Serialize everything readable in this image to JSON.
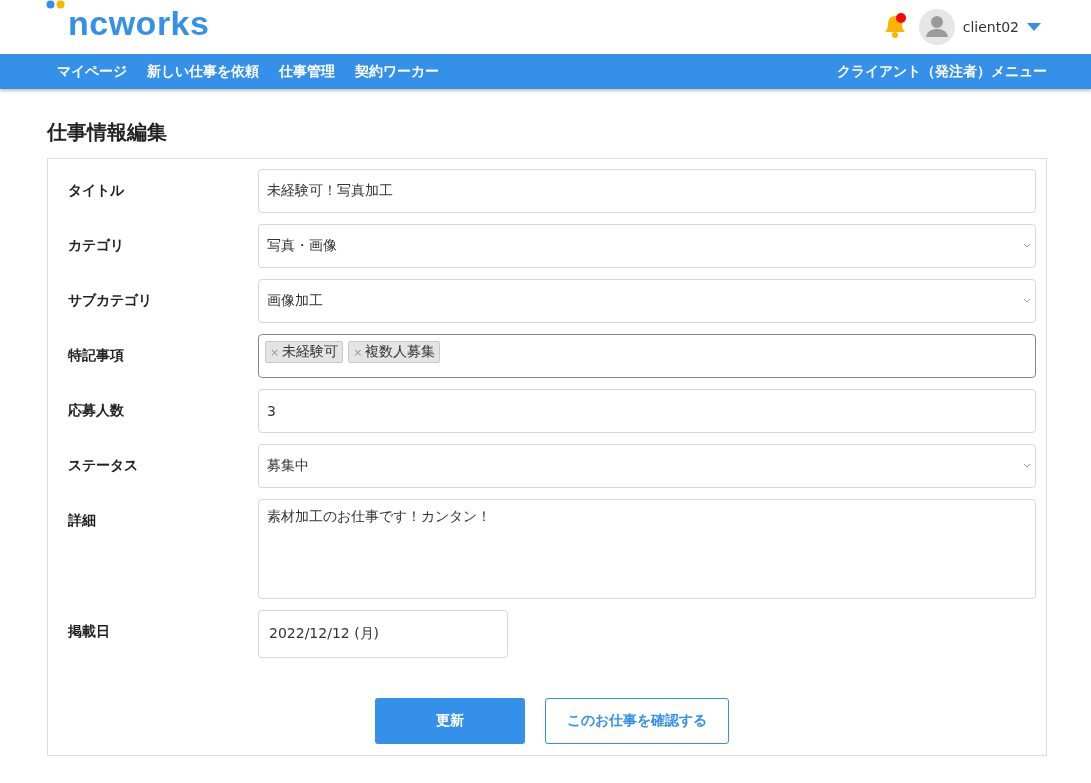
{
  "header": {
    "logo": "ncworks",
    "notification": {
      "unread": true
    },
    "user": {
      "name": "client02"
    }
  },
  "nav": {
    "items": [
      "マイページ",
      "新しい仕事を依頼",
      "仕事管理",
      "契約ワーカー"
    ],
    "menu_label": "クライアント（発注者）メニュー"
  },
  "page_title": "仕事情報編集",
  "form": {
    "fields": [
      {
        "kind": "text",
        "label": "タイトル",
        "value": "未経験可！写真加工"
      },
      {
        "kind": "select",
        "label": "カテゴリ",
        "value": "写真・画像"
      },
      {
        "kind": "select",
        "label": "サブカテゴリ",
        "value": "画像加工"
      },
      {
        "kind": "tags",
        "label": "特記事項",
        "remove_mark": "×",
        "tags": [
          "未経験可",
          "複数人募集"
        ]
      },
      {
        "kind": "text",
        "label": "応募人数",
        "value": "3"
      },
      {
        "kind": "select",
        "label": "ステータス",
        "value": "募集中"
      },
      {
        "kind": "textarea",
        "label": "詳細",
        "value": "素材加工のお仕事です！カンタン！"
      },
      {
        "kind": "date",
        "label": "掲載日",
        "value": "2022/12/12 (月)"
      }
    ],
    "buttons": [
      {
        "kind": "primary",
        "label": "更新"
      },
      {
        "kind": "outline",
        "label": "このお仕事を確認する"
      }
    ]
  }
}
